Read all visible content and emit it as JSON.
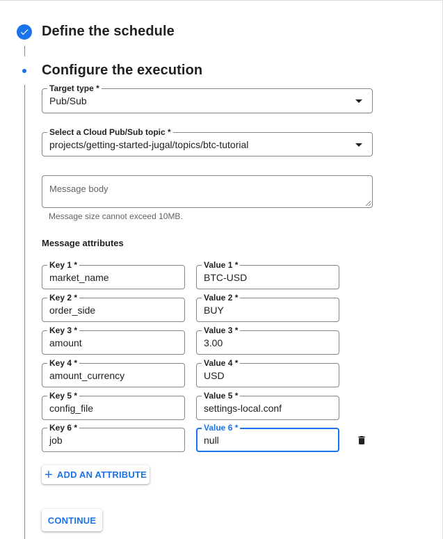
{
  "steps": {
    "step1_title": "Define the schedule",
    "step2_title": "Configure the execution"
  },
  "target_type": {
    "label": "Target type *",
    "value": "Pub/Sub"
  },
  "topic": {
    "label": "Select a Cloud Pub/Sub topic *",
    "value": "projects/getting-started-jugal/topics/btc-tutorial"
  },
  "message_body": {
    "placeholder": "Message body",
    "hint": "Message size cannot exceed 10MB."
  },
  "attributes": {
    "title": "Message attributes",
    "rows": [
      {
        "key_label": "Key 1 *",
        "key": "market_name",
        "value_label": "Value 1 *",
        "value": "BTC-USD"
      },
      {
        "key_label": "Key 2 *",
        "key": "order_side",
        "value_label": "Value 2 *",
        "value": "BUY"
      },
      {
        "key_label": "Key 3 *",
        "key": "amount",
        "value_label": "Value 3 *",
        "value": "3.00"
      },
      {
        "key_label": "Key 4 *",
        "key": "amount_currency",
        "value_label": "Value 4 *",
        "value": "USD"
      },
      {
        "key_label": "Key 5 *",
        "key": "config_file",
        "value_label": "Value 5 *",
        "value": "settings-local.conf"
      },
      {
        "key_label": "Key 6 *",
        "key": "job",
        "value_label": "Value 6 *",
        "value": "null"
      }
    ]
  },
  "buttons": {
    "add_attribute": "ADD AN ATTRIBUTE",
    "continue": "CONTINUE"
  },
  "icons": {
    "step_done": "check-icon",
    "step_active": "active-dot-icon",
    "add": "plus-icon",
    "delete": "trash-icon",
    "dropdown": "caret-down-icon"
  },
  "colors": {
    "accent": "#1a73e8",
    "border": "#80868b",
    "text": "#202124",
    "muted": "#5f6368"
  }
}
